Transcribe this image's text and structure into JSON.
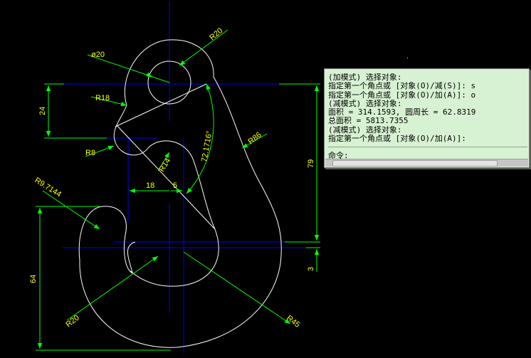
{
  "colors": {
    "background": "#000000",
    "geometry": "#ffffff",
    "centerlines": "#0000ff",
    "dimensions": "#00ff00",
    "dimension_text": "#ffff00",
    "command_bg": "#d7f2d2"
  },
  "dimensions": {
    "r20_top": "R20",
    "dia20": "ø20",
    "r18": "R18",
    "d24": "24",
    "r8": "R8",
    "r14": "R14",
    "angle": "72.1716°",
    "r86": "R86",
    "d79": "79",
    "r9_7144": "R9.7144",
    "d18": "18",
    "d5": "5",
    "d64": "64",
    "d3": "3",
    "r20_bottom": "R20",
    "r45": "R45"
  },
  "command_window": {
    "lines": [
      "(加模式) 选择对象:",
      "指定第一个角点或 [对象(O)/减(S)]: s",
      "指定第一个角点或 [对象(O)/加(A)]: o",
      "(减模式) 选择对象:",
      "面积 = 314.1593, 圆周长 = 62.8319",
      "总面积 = 5813.7355",
      "(减模式) 选择对象:",
      "指定第一个角点或 [对象(O)/加(A)]:"
    ],
    "prompt": "命令:"
  }
}
